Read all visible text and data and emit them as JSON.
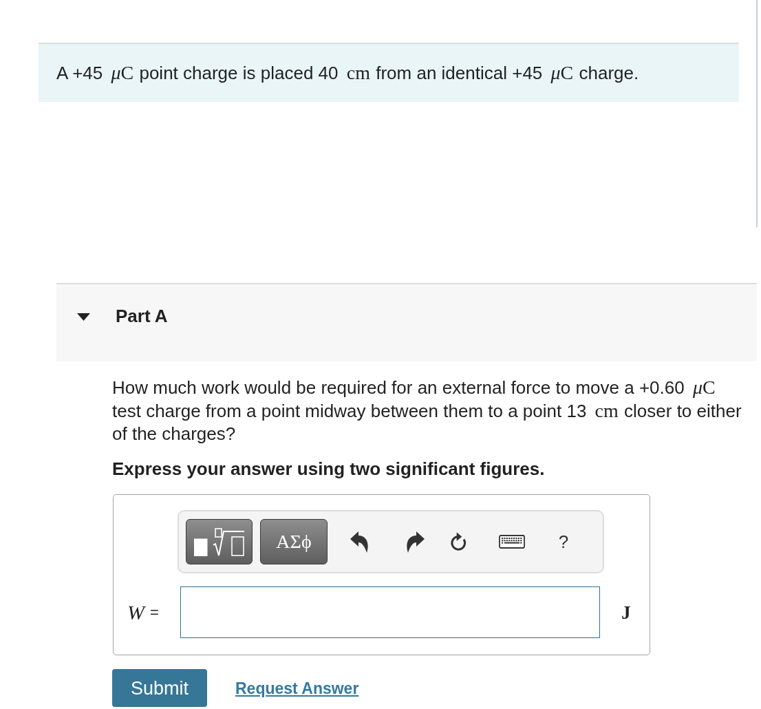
{
  "intro": {
    "segments": [
      {
        "kind": "text",
        "text": "A +45 "
      },
      {
        "kind": "math",
        "parts": [
          {
            "text": "μ",
            "italic": true
          },
          {
            "text": "C",
            "italic": false
          }
        ]
      },
      {
        "kind": "text",
        "text": " point charge is placed 40 "
      },
      {
        "kind": "math",
        "parts": [
          {
            "text": "cm",
            "italic": false
          }
        ]
      },
      {
        "kind": "text",
        "text": " from an identical +45 "
      },
      {
        "kind": "math",
        "parts": [
          {
            "text": "μ",
            "italic": true
          },
          {
            "text": "C",
            "italic": false
          }
        ]
      },
      {
        "kind": "text",
        "text": " charge."
      }
    ]
  },
  "part": {
    "title": "Part A",
    "expanded": true
  },
  "question": {
    "segments": [
      {
        "kind": "text",
        "text": "How much work would be required for an external force to move a +0.60 "
      },
      {
        "kind": "math",
        "parts": [
          {
            "text": "μ",
            "italic": true
          },
          {
            "text": "C",
            "italic": false
          }
        ]
      },
      {
        "kind": "text",
        "text": " test charge from a point midway between them to a point 13 "
      },
      {
        "kind": "math",
        "parts": [
          {
            "text": "cm",
            "italic": false
          }
        ]
      },
      {
        "kind": "text",
        "text": " closer to either of the charges?"
      }
    ]
  },
  "instruction": "Express your answer using two significant figures.",
  "answer": {
    "toolbar": [
      {
        "kind": "templates"
      },
      {
        "kind": "symbols",
        "label": "ΑΣϕ"
      },
      {
        "kind": "undo"
      },
      {
        "kind": "redo"
      },
      {
        "kind": "reset"
      },
      {
        "kind": "keyboard"
      },
      {
        "kind": "help",
        "label": "?"
      }
    ],
    "variable": "W",
    "equals": "=",
    "unit": "J"
  },
  "actions": {
    "submit": "Submit",
    "request_answer": "Request Answer"
  }
}
